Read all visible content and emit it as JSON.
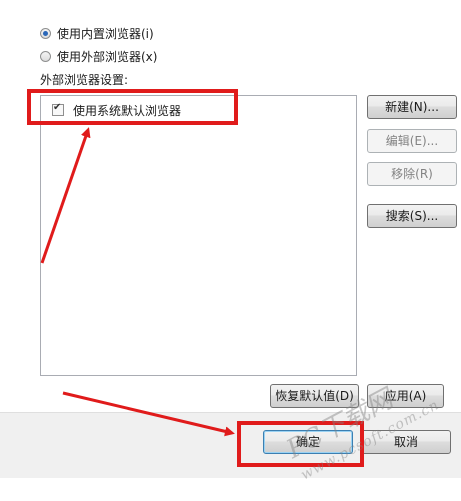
{
  "options": {
    "builtin_browser": "使用内置浏览器(i)",
    "external_browser": "使用外部浏览器(x)",
    "selected": "builtin"
  },
  "external_settings": {
    "label": "外部浏览器设置:",
    "items": [
      {
        "label": "使用系统默认浏览器",
        "checked": true
      }
    ]
  },
  "buttons": {
    "new": "新建(N)...",
    "edit": "编辑(E)...",
    "remove": "移除(R)",
    "search": "搜索(S)...",
    "restore_defaults": "恢复默认值(D)",
    "apply": "应用(A)",
    "ok": "确定",
    "cancel": "取消"
  },
  "watermark": {
    "line1": "PC下载网",
    "line2": "www.pcsoft.com.cn"
  },
  "colors": {
    "annotation_red": "#e01b1b",
    "accent": "#2a67b8"
  }
}
